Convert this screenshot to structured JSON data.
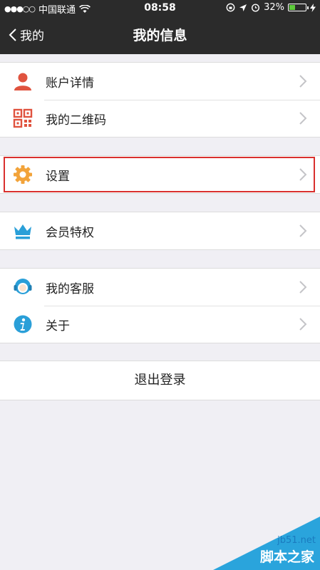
{
  "statusbar": {
    "carrier": "中国联通",
    "time": "08:58",
    "battery": "32%"
  },
  "navbar": {
    "back_label": "我的",
    "title": "我的信息"
  },
  "groups": [
    {
      "items": [
        {
          "label": "账户详情",
          "icon": "person-icon"
        },
        {
          "label": "我的二维码",
          "icon": "qr-code-icon"
        }
      ]
    },
    {
      "items": [
        {
          "label": "设置",
          "icon": "gear-icon"
        }
      ]
    },
    {
      "items": [
        {
          "label": "会员特权",
          "icon": "crown-icon"
        }
      ]
    },
    {
      "items": [
        {
          "label": "我的客服",
          "icon": "customer-service-icon"
        },
        {
          "label": "关于",
          "icon": "info-icon"
        }
      ]
    }
  ],
  "logout_label": "退出登录",
  "watermark": {
    "url": "jb51.net",
    "brand": "脚本之家"
  },
  "colors": {
    "navbar": "#2b2b2b",
    "background": "#f0eff4",
    "highlight": "#d9302e",
    "accent_blue": "#2aa4dc"
  }
}
